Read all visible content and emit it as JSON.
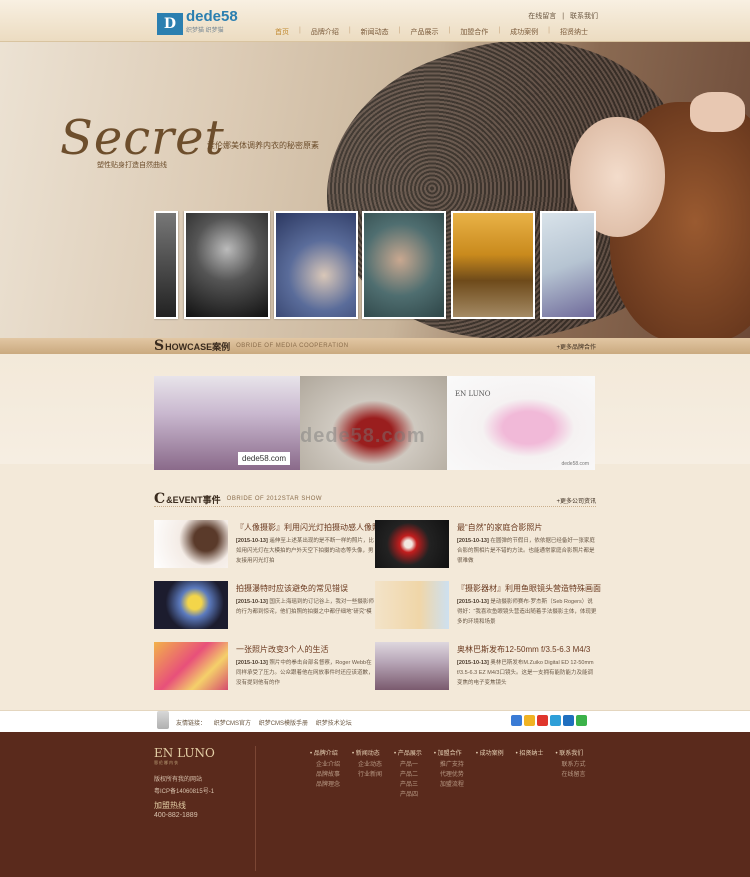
{
  "header": {
    "logo_mark": "D",
    "logo_text": "dede58",
    "logo_sub": "织梦猫 织梦猫",
    "top_links": [
      "在线留言",
      "|",
      "联系我们"
    ],
    "nav": [
      "首页",
      "品牌介绍",
      "新闻动态",
      "产品展示",
      "加盟合作",
      "成功案例",
      "招贤纳士"
    ],
    "nav_sep": "|"
  },
  "banner": {
    "script_title": "Secret",
    "tagline": "爱伦娜美体调养内衣的秘密原素",
    "tagline2": "塑性贴身打造自然曲线"
  },
  "showcase": {
    "cap": "S",
    "title": "HOWCASE案例",
    "subtitle": "OBRIDE OF MEDIA COOPERATION",
    "more": "+更多品牌合作",
    "image_caption": "dede58.com",
    "watermark": "dede58.com",
    "brand_tag": "EN LUNO",
    "brand_url": "dede58.com"
  },
  "event": {
    "cap": "C",
    "title": "&EVENT事件",
    "subtitle": "OBRIDE OF 2012STAR SHOW",
    "more": "+更多公司资讯",
    "items": [
      {
        "title": "『人像摄影』利用闪光灯拍摄动感人像照",
        "date": "[2015-10-13]",
        "text": "遥伸至上述某出现的是不断一样的照片，比如用闪光灯在大模拍的户外天空下拍摄的动态等头像，男友接用闪光灯拍"
      },
      {
        "title": "最“自然”的家庭合影照片",
        "date": "[2015-10-13]",
        "text": "在圆弹的节假日，依依据已经备好一张家庭合影的照相片是不错的方法。也能通常家庭合影照片都是很难做"
      },
      {
        "title": "拍摄瀑特时应该避免的常见错误",
        "date": "[2015-10-13]",
        "text": "国庆上海瑶到的订记谷上，我对一些摄影师的行为都到惊诧，他们拍照的拍摄之中都仔细地“研究”模"
      },
      {
        "title": "『摄影器材』利用鱼眼镜头营造特殊画面",
        "date": "[2015-10-13]",
        "text": "是动摄影师赛布·罗杰斯（Seb Rogers）说得好：“我喜欢鱼眼镜头营造出随着手法摄影主体，体现更多的环境和场景"
      },
      {
        "title": "一张照片改变3个人的生活",
        "date": "[2015-10-13]",
        "text": "照片中的拳击台部名督察，Roger Webb在同样承受了压力。公众跟着他在网放事件时还应该道歉，没有提到他有的作"
      },
      {
        "title": "奥林巴斯发布12-50mm f/3.5-6.3 M4/3",
        "date": "[2015-10-13]",
        "text": "奥林巴斯发布M.Zuiko Digital ED 12-50mm f/3.5-6.3 EZ M4/3口镜头。这是一支拥有能防能力及能调变焦的电子变焦镜头"
      }
    ]
  },
  "links": {
    "label": "友情链接：",
    "items": [
      "织梦CMS官方",
      "织梦CMS模版手册",
      "织梦技术论坛"
    ]
  },
  "footer": {
    "logo": "EN LUNO",
    "logo_sub": "恩伦娜内衣",
    "copyright": "版权所有我的网站",
    "icp": "粤ICP备14060815号-1",
    "hotline_label": "加盟热线",
    "phone": "400-882-1889",
    "columns": [
      {
        "head": "品牌介绍",
        "items": [
          "企业介绍",
          "品牌故事",
          "品牌理念"
        ]
      },
      {
        "head": "新闻动态",
        "items": [
          "企业动态",
          "行业新闻"
        ]
      },
      {
        "head": "产品展示",
        "items": [
          "产品一",
          "产品二",
          "产品三",
          "产品四"
        ]
      },
      {
        "head": "加盟合作",
        "items": [
          "推广支持",
          "代理优势",
          "加盟流程"
        ]
      },
      {
        "head": "成功案例",
        "items": []
      },
      {
        "head": "招贤纳士",
        "items": []
      },
      {
        "head": "联系我们",
        "items": [
          "联系方式",
          "在线留言"
        ]
      }
    ]
  }
}
